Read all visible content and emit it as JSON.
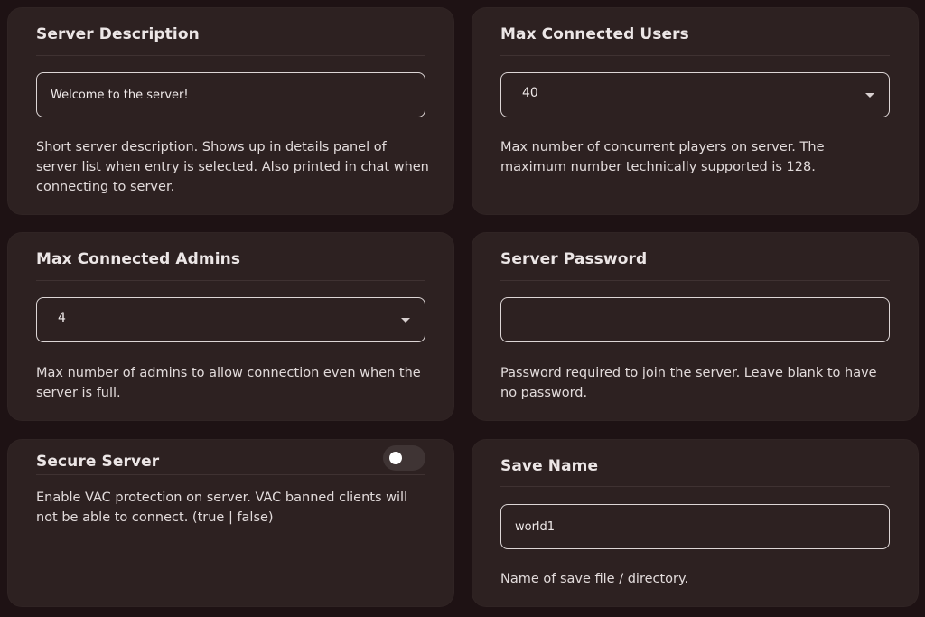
{
  "server_description": {
    "title": "Server Description",
    "value": "Welcome to the server!",
    "help": "Short server description. Shows up in details panel of server list when entry is selected. Also printed in chat when connecting to server."
  },
  "max_connected_users": {
    "title": "Max Connected Users",
    "selected": "40",
    "help": "Max number of concurrent players on server. The maximum number technically supported is 128."
  },
  "max_connected_admins": {
    "title": "Max Connected Admins",
    "selected": "4",
    "help": "Max number of admins to allow connection even when the server is full."
  },
  "server_password": {
    "title": "Server Password",
    "value": "",
    "help": "Password required to join the server. Leave blank to have no password."
  },
  "secure_server": {
    "title": "Secure Server",
    "enabled": false,
    "help": "Enable VAC protection on server. VAC banned clients will not be able to connect. (true | false)"
  },
  "save_name": {
    "title": "Save Name",
    "value": "world1",
    "help": "Name of save file / directory."
  },
  "colors": {
    "background": "#1e1214",
    "card": "#2d2121",
    "field_border": "#ddd6d6",
    "text": "#ece6e6",
    "toggle_off": "#3f3434"
  }
}
